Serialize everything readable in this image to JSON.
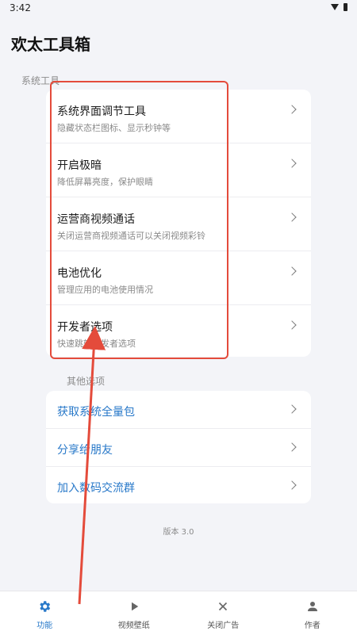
{
  "status": {
    "time": "3:42",
    "wifi_icon": "wifi-icon",
    "battery_icon": "battery-icon"
  },
  "app": {
    "title": "欢太工具箱"
  },
  "system_tools": {
    "label": "系统工具",
    "items": [
      {
        "title": "系统界面调节工具",
        "subtitle": "隐藏状态栏图标、显示秒钟等"
      },
      {
        "title": "开启极暗",
        "subtitle": "降低屏幕亮度，保护眼睛"
      },
      {
        "title": "运营商视频通话",
        "subtitle": "关闭运营商视频通话可以关闭视频彩铃"
      },
      {
        "title": "电池优化",
        "subtitle": "管理应用的电池使用情况"
      },
      {
        "title": "开发者选项",
        "subtitle": "快速跳转开发者选项"
      }
    ]
  },
  "other_options": {
    "label": "其他选项",
    "items": [
      {
        "title": "获取系统全量包"
      },
      {
        "title": "分享给朋友"
      },
      {
        "title": "加入数码交流群"
      }
    ]
  },
  "version": "版本 3.0",
  "bottom_nav": {
    "items": [
      {
        "label": "功能",
        "icon": "gear-icon",
        "active": true
      },
      {
        "label": "视频壁纸",
        "icon": "play-icon",
        "active": false
      },
      {
        "label": "关闭广告",
        "icon": "close-icon",
        "active": false
      },
      {
        "label": "作者",
        "icon": "person-icon",
        "active": false
      }
    ]
  },
  "colors": {
    "accent": "#2979c9",
    "annotation": "#e44b3b",
    "background": "#f3f4f8"
  }
}
